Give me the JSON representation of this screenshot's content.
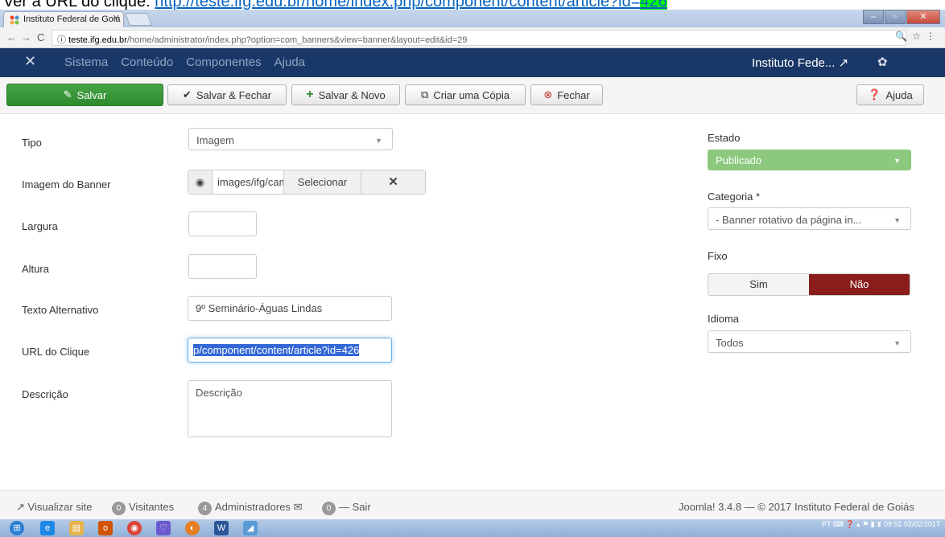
{
  "caption": {
    "prefix": "Ver a URL do clique: ",
    "link": "http://teste.ifg.edu.br/home/index.php/component/content/article?id=",
    "link_end": "426"
  },
  "browser": {
    "tab_title": "Instituto Federal de Goiá",
    "tab_close": "×",
    "url_host": "teste.ifg.edu.br",
    "url_path": "/home/administrator/index.php?option=com_banners&view=banner&layout=edit&id=29",
    "back": "←",
    "forward": "→",
    "reload": "C",
    "info": "ⓘ",
    "right_icons": "🔍☆⋮"
  },
  "navbar": {
    "logo": "✕",
    "menu": [
      "Sistema",
      "Conteúdo",
      "Componentes",
      "Ajuda"
    ],
    "site_link": "Instituto Fede...",
    "site_icon": "↗",
    "gear": "✿"
  },
  "toolbar": {
    "save": "Salvar",
    "save_close": "Salvar & Fechar",
    "save_new": "Salvar & Novo",
    "copy": "Criar uma Cópia",
    "close": "Fechar",
    "help": "Ajuda"
  },
  "form": {
    "tipo": {
      "label": "Tipo",
      "value": "Imagem"
    },
    "imagem": {
      "label": "Imagem do Banner",
      "value": "images/ifg/camp",
      "select": "Selecionar",
      "clear": "✕"
    },
    "largura": {
      "label": "Largura",
      "value": ""
    },
    "altura": {
      "label": "Altura",
      "value": ""
    },
    "alt": {
      "label": "Texto Alternativo",
      "value": "9º Seminário-Águas Lindas"
    },
    "url": {
      "label": "URL do Clique",
      "value": "p/component/content/article?id=426"
    },
    "descricao": {
      "label": "Descrição",
      "placeholder": "Descrição"
    }
  },
  "sidebar": {
    "estado": {
      "label": "Estado",
      "value": "Publicado"
    },
    "categoria": {
      "label": "Categoria *",
      "value": "- Banner rotativo da página in..."
    },
    "fixo": {
      "label": "Fixo",
      "sim": "Sim",
      "nao": "Não"
    },
    "idioma": {
      "label": "Idioma",
      "value": "Todos"
    }
  },
  "footer": {
    "view_site": "Visualizar site",
    "visitors_count": "0",
    "visitors": "Visitantes",
    "admins_count": "4",
    "admins": "Administradores",
    "messages_count": "0",
    "logout": "Sair",
    "version": "Joomla! 3.4.8 — © 2017 Instituto Federal de Goiás"
  },
  "taskbar": {
    "lang": "PT",
    "time": "09:51",
    "date": "02/02/2017"
  },
  "colors": {
    "navbar": "#1a3867",
    "save_green": "#2d8a2d",
    "published": "#8cc97e",
    "nao_red": "#8b1c1c"
  }
}
